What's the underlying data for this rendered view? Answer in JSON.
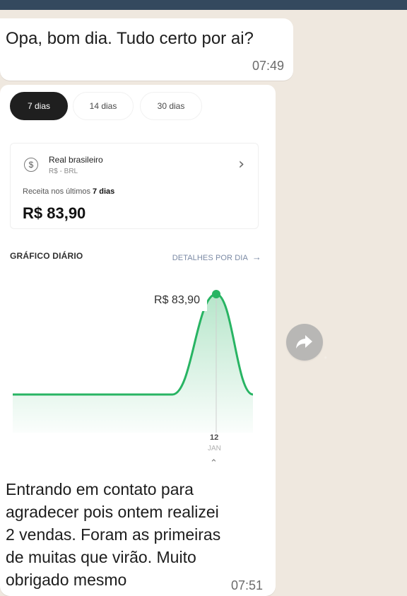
{
  "chat": {
    "message1": {
      "text": "Opa, bom dia. Tudo certo por ai?",
      "time": "07:49"
    },
    "message2": {
      "text": "Entrando em contato para\nagradecer pois ontem realizei\n2 vendas. Foram as primeiras\nde muitas que virão. Muito\nobrigado mesmo",
      "time": "07:51"
    }
  },
  "analytics": {
    "tabs": [
      {
        "label": "7 dias",
        "active": true
      },
      {
        "label": "14 dias",
        "active": false
      },
      {
        "label": "30 dias",
        "active": false
      }
    ],
    "currency": {
      "icon": "dollar-circle-icon",
      "name": "Real brasileiro",
      "code": "R$ - BRL"
    },
    "revenue": {
      "label_prefix": "Receita nos últimos ",
      "label_period": "7 dias",
      "value": "R$ 83,90"
    },
    "section": {
      "title": "GRÁFICO DIÁRIO",
      "link": "DETALHES POR DIA",
      "link_icon": "arrow-right-icon"
    },
    "chart_highlight_label": "R$ 83,90",
    "x_day": "12",
    "x_month": "JAN",
    "caret_icon": "chevron-up-icon"
  },
  "colors": {
    "accent": "#28b463",
    "chip_active": "#1f1f1f",
    "link": "#7b8aa5",
    "forward_button": "#aaaaaa"
  },
  "chart_data": {
    "type": "area",
    "x": [
      "",
      "",
      "",
      "",
      "",
      "12 JAN",
      ""
    ],
    "values": [
      0,
      0,
      0,
      0,
      0,
      83.9,
      0
    ],
    "highlight_index": 5,
    "highlight_label": "R$ 83,90",
    "grid": false
  }
}
